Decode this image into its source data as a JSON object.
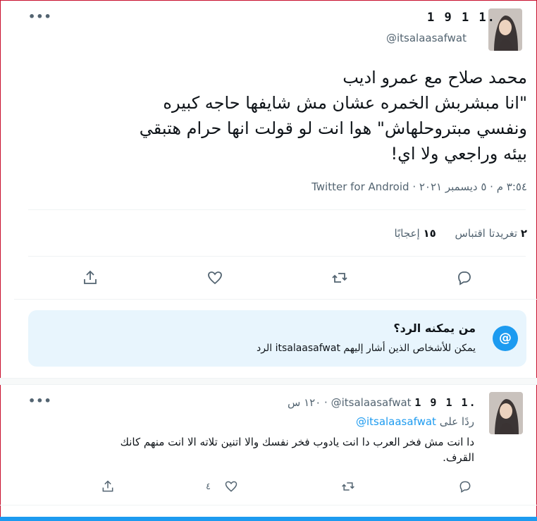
{
  "main_tweet": {
    "author_name": "1 9 1 1.",
    "author_handle": "@itsalaasafwat",
    "text_line1": "محمد صلاح مع عمرو اديب",
    "text_line2": "\"انا مبشربش الخمره عشان مش شايفها حاجه كبيره",
    "text_line3": "ونفسي مبتروحلهاش\" هوا انت لو قولت انها حرام هتبقي",
    "text_line4": "بيئه وراجعي ولا اي!",
    "timestamp": "٣:٥٤ م · ٥ ديسمبر ٢٠٢١ · Twitter for Android",
    "quote_tweets_count": "٢",
    "quote_tweets_label": "تغريدتا اقتباس",
    "likes_count": "١٥",
    "likes_label": "إعجابًا"
  },
  "who_can_reply": {
    "title": "من يمكنه الرد؟",
    "description": "يمكن للأشخاص الذين أشار إليهم itsalaasafwat الرد",
    "icon_glyph": "@"
  },
  "reply_tweet": {
    "author_name": "1 9 1 1.",
    "author_handle": "@itsalaasafwat",
    "time_ago": "١٢٠ س",
    "replying_prefix": "ردًا على",
    "replying_handle": "@itsalaasafwat",
    "text_line1": "دا انت مش فخر العرب دا انت يادوب فخر نفسك والا اتنين تلاته الا انت منهم كانك",
    "text_line2": "القرف.",
    "likes_count": "٤"
  },
  "icons": {
    "more": "more-icon",
    "reply": "reply-icon",
    "retweet": "retweet-icon",
    "like": "heart-icon",
    "share": "share-icon"
  },
  "colors": {
    "accent": "#1d9bf0",
    "reply_box_bg": "#e8f5fd",
    "secondary_text": "#536471"
  }
}
